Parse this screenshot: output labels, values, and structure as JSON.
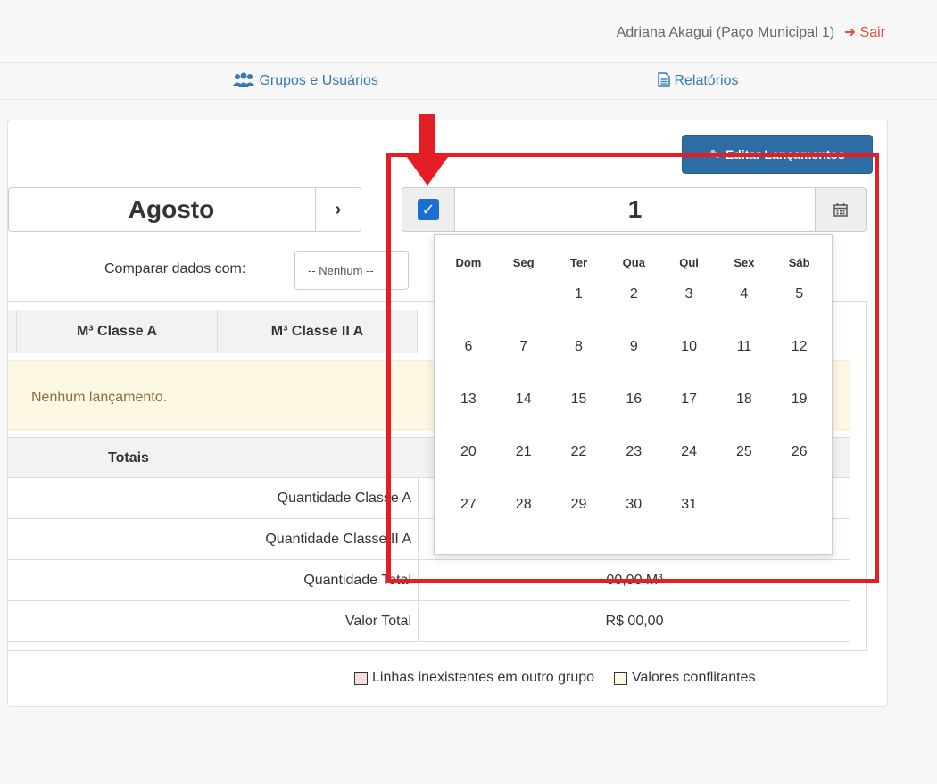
{
  "header": {
    "user": "Adriana Akagui (Paço Municipal 1)",
    "logout_label": "Sair",
    "logout_icon": "sign-out-icon"
  },
  "nav": {
    "groups_label": "Grupos e Usuários",
    "reports_label": "Relatórios"
  },
  "toolbar": {
    "edit_label": "Editar Lançamentos"
  },
  "month_picker": {
    "month": "Agosto",
    "next_symbol": "›"
  },
  "day_picker": {
    "checked": true,
    "day": "1"
  },
  "compare": {
    "label": "Comparar dados com:",
    "selected": "-- Nenhum --"
  },
  "table": {
    "headers": [
      "M³ Classe A",
      "M³ Classe II A"
    ],
    "empty_message": "Nenhum lançamento.",
    "totals_label": "Totais",
    "totals": [
      {
        "label": "Quantidade Classe A",
        "value": ""
      },
      {
        "label": "Quantidade Classe II A",
        "value": ""
      },
      {
        "label": "Quantidade Total",
        "value": "00,00 M³"
      },
      {
        "label": "Valor Total",
        "value": "R$ 00,00"
      }
    ]
  },
  "legend": {
    "missing_lines": "Linhas inexistentes em outro grupo",
    "conflicts": "Valores conflitantes",
    "missing_color": "#f2dede",
    "conflict_color": "#fcf8e3"
  },
  "calendar": {
    "weekdays": [
      "Dom",
      "Seg",
      "Ter",
      "Qua",
      "Qui",
      "Sex",
      "Sáb"
    ],
    "weeks": [
      [
        "",
        "",
        "1",
        "2",
        "3",
        "4",
        "5"
      ],
      [
        "6",
        "7",
        "8",
        "9",
        "10",
        "11",
        "12"
      ],
      [
        "13",
        "14",
        "15",
        "16",
        "17",
        "18",
        "19"
      ],
      [
        "20",
        "21",
        "22",
        "23",
        "24",
        "25",
        "26"
      ],
      [
        "27",
        "28",
        "29",
        "30",
        "31",
        "",
        ""
      ]
    ]
  },
  "colors": {
    "accent": "#337ab7",
    "annotation": "#e51d25"
  }
}
